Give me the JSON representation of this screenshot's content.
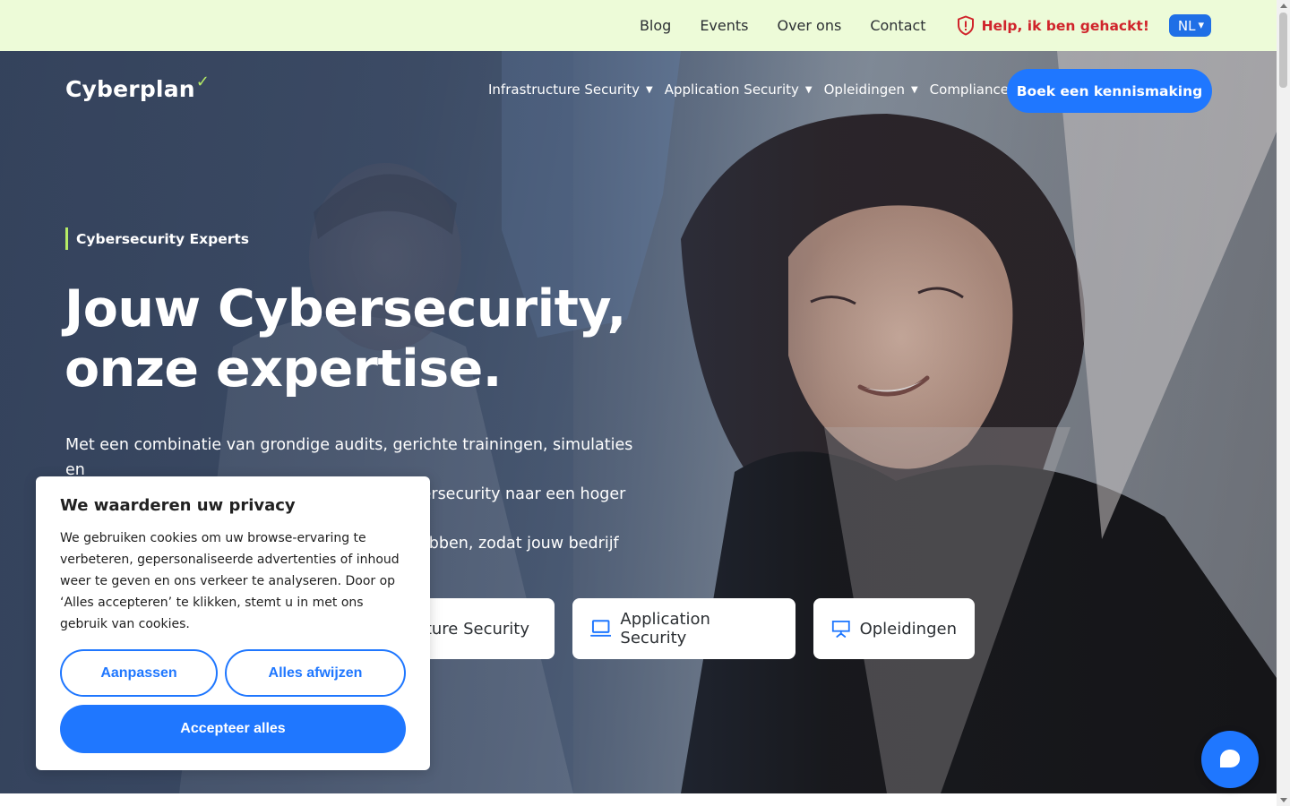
{
  "topbar": {
    "links": [
      "Blog",
      "Events",
      "Over ons",
      "Contact"
    ],
    "hacked_label": "Help, ik ben gehackt!",
    "lang_label": "NL",
    "lang_caret": "▾"
  },
  "brand": {
    "name": "Cyberplan",
    "mark": "✓"
  },
  "mainnav": {
    "items": [
      "Infrastructure Security",
      "Application Security",
      "Opleidingen",
      "Compliance"
    ],
    "caret": "▼",
    "cta_label": "Boek een kennismaking"
  },
  "hero": {
    "eyebrow": "Cybersecurity Experts",
    "headline_line1": "Jouw Cybersecurity,",
    "headline_line2": "onze expertise.",
    "lead_line1": "Met een combinatie van grondige audits, gerichte trainingen, simulaties en",
    "lead_line2": "strategische risicoanalyses breng je jouw cybersecurity naar een hoger",
    "lead_line3": "",
    "lead_line4": "ebben, zodat jouw bedrijf",
    "pills": {
      "infra": "ture Security",
      "app": "Application Security",
      "opl": "Opleidingen"
    }
  },
  "cookie": {
    "title": "We waarderen uw privacy",
    "text": "We gebruiken cookies om uw browse-ervaring te verbeteren, gepersonaliseerde advertenties of inhoud weer te geven en ons verkeer te analyseren. Door op ‘Alles accepteren’ te klikken, stemt u in met ons gebruik van cookies.",
    "customize_label": "Aanpassen",
    "reject_label": "Alles afwijzen",
    "accept_label": "Accepteer alles"
  },
  "colors": {
    "accent_blue": "#1f77ff",
    "alert_red": "#d0242b",
    "lime": "#b6ec66",
    "topbar_bg": "#edfbd8"
  },
  "icons": {
    "hacked": "shield-alert-icon",
    "app_pill": "laptop-icon",
    "opl_pill": "presentation-icon",
    "chat": "chat-bubble-icon"
  }
}
